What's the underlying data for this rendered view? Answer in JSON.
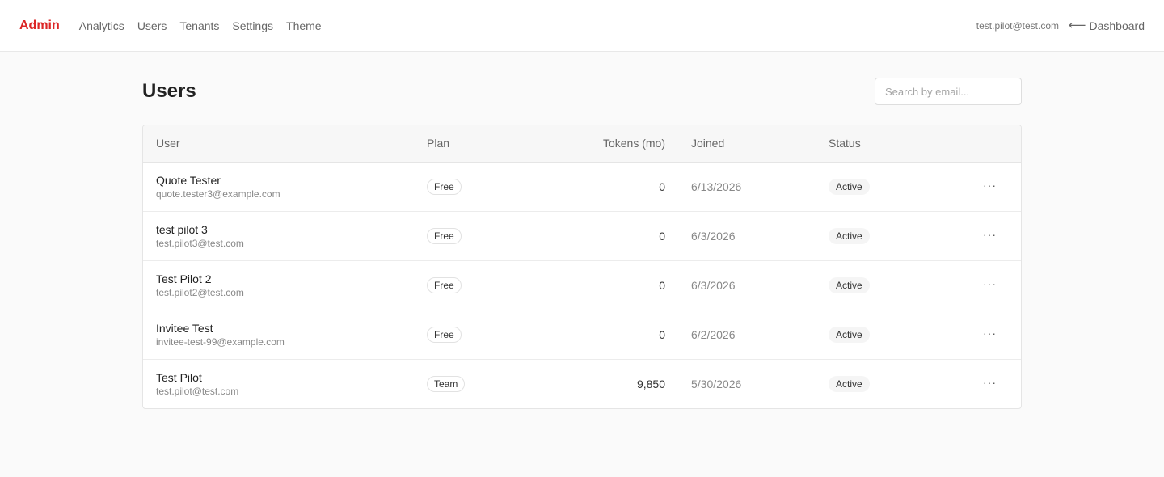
{
  "nav": {
    "brand": "Admin",
    "links": [
      "Analytics",
      "Users",
      "Tenants",
      "Settings",
      "Theme"
    ],
    "current_user": "test.pilot@test.com",
    "back_label": "Dashboard",
    "back_arrow": "⟵"
  },
  "page": {
    "title": "Users",
    "search_placeholder": "Search by email..."
  },
  "table": {
    "columns": [
      "User",
      "Plan",
      "Tokens (mo)",
      "Joined",
      "Status"
    ],
    "rows": [
      {
        "name": "Quote Tester",
        "email": "quote.tester3@example.com",
        "plan": "Free",
        "tokens": "0",
        "joined": "6/13/2026",
        "status": "Active"
      },
      {
        "name": "test pilot 3",
        "email": "test.pilot3@test.com",
        "plan": "Free",
        "tokens": "0",
        "joined": "6/3/2026",
        "status": "Active"
      },
      {
        "name": "Test Pilot 2",
        "email": "test.pilot2@test.com",
        "plan": "Free",
        "tokens": "0",
        "joined": "6/3/2026",
        "status": "Active"
      },
      {
        "name": "Invitee Test",
        "email": "invitee-test-99@example.com",
        "plan": "Free",
        "tokens": "0",
        "joined": "6/2/2026",
        "status": "Active"
      },
      {
        "name": "Test Pilot",
        "email": "test.pilot@test.com",
        "plan": "Team",
        "tokens": "9,850",
        "joined": "5/30/2026",
        "status": "Active"
      }
    ],
    "row_action_glyph": "···"
  },
  "colors": {
    "brand": "#dc2626",
    "background": "#fafafa",
    "border": "#e5e5e5"
  }
}
